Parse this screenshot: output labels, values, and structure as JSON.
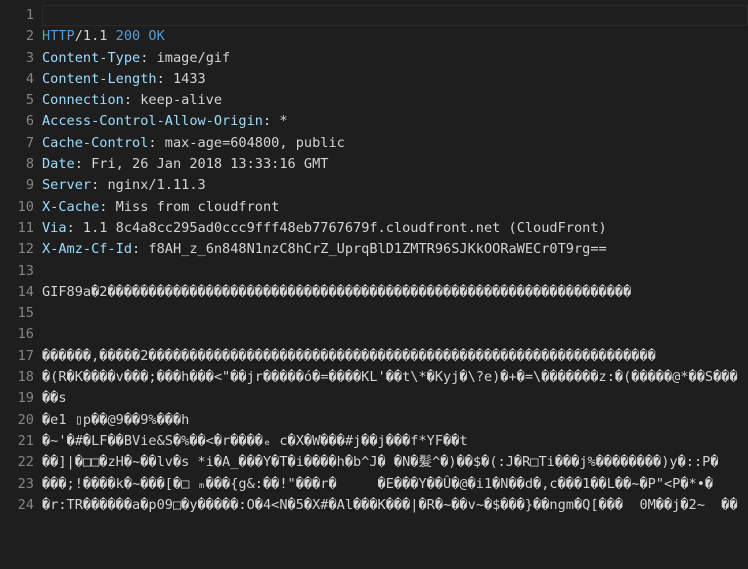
{
  "line_numbers": [
    "1",
    "2",
    "3",
    "4",
    "5",
    "6",
    "7",
    "8",
    "9",
    "10",
    "11",
    "12",
    "13",
    "14",
    "15",
    "16",
    "17",
    "18",
    "19",
    "20",
    "21",
    "22",
    "23",
    "24"
  ],
  "status_line": {
    "protocol": "HTTP",
    "version": "/1.1 ",
    "code": "200",
    "text": " OK"
  },
  "headers": [
    {
      "key": "Content-Type",
      "value": ": image/gif"
    },
    {
      "key": "Content-Length",
      "value": ": 1433"
    },
    {
      "key": "Connection",
      "value": ": keep-alive"
    },
    {
      "key": "Access-Control-Allow-Origin",
      "value": ": *"
    },
    {
      "key": "Cache-Control",
      "value": ": max-age=604800, public"
    },
    {
      "key": "Date",
      "value": ": Fri, 26 Jan 2018 13:33:16 GMT"
    },
    {
      "key": "Server",
      "value": ": nginx/1.11.3"
    },
    {
      "key": "X-Cache",
      "value": ": Miss from cloudfront"
    },
    {
      "key": "Via",
      "value": ": 1.1 8c4a8cc295ad0ccc9fff48eb7767679f.cloudfront.net (CloudFront)"
    },
    {
      "key": "X-Amz-Cf-Id",
      "value": ": f8AH_z_6n848N1nzC8hCrZ_UprqBlD1ZMTR96SJKkOORaWECr0T9rg=="
    }
  ],
  "body_lines": [
    "",
    "GIF89a�2����������������������������������������������������������������",
    "",
    "",
    "������,�����2��������������������������������������������������������������",
    "�(R�K����v���;���h���<\"��jr�����ó�=����KL'��t\\*�Kyj�\\?e)�+�=\\�������z:�(�����@*��S���",
    "��s",
    "�e1 ▯p��@9��9%���h",
    "�~'�#�LF��BVie&S�%��<�r����ₑ c�X�W���#j��j���f*YF��t",
    "��]|�□□�zH�~��lv�s *i�A_���Y�T�i����h�b^J� �N�髪^�)��$�(:J�R□Ti���j%��������)y�::P�",
    "���;!����k�~���[�□ ₘ���{g&:��!\"���r�     �E���Y��Û�@�i1�N��d�,c���1��L��~�P\"<P�*•�",
    "�r:TR������a�p09□�y�����:O�4<N�5�X#�Al���K���|�R�~��v~�$���}��ngm�Q[���  0M��j�2~  ��"
  ]
}
